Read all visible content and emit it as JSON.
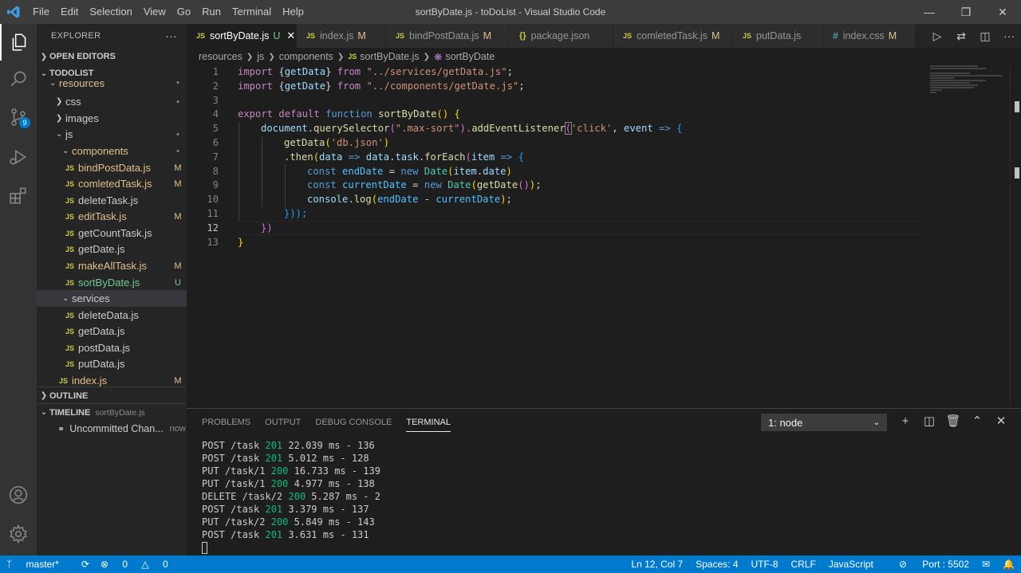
{
  "app": {
    "window_title": "sortByDate.js - toDoList - Visual Studio Code",
    "menu": [
      "File",
      "Edit",
      "Selection",
      "View",
      "Go",
      "Run",
      "Terminal",
      "Help"
    ]
  },
  "sidebar": {
    "title": "EXPLORER",
    "open_editors": "OPEN EDITORS",
    "project": "TODOLIST",
    "tree": [
      {
        "label": "resources",
        "status": "•"
      },
      {
        "label": "css",
        "status": "•"
      },
      {
        "label": "images",
        "status": ""
      },
      {
        "label": "js",
        "status": "•"
      },
      {
        "label": "components",
        "status": "•"
      },
      {
        "label": "bindPostData.js",
        "status": "M"
      },
      {
        "label": "comletedTask.js",
        "status": "M"
      },
      {
        "label": "deleteTask.js",
        "status": ""
      },
      {
        "label": "editTask.js",
        "status": "M"
      },
      {
        "label": "getCountTask.js",
        "status": ""
      },
      {
        "label": "getDate.js",
        "status": ""
      },
      {
        "label": "makeAllTask.js",
        "status": "M"
      },
      {
        "label": "sortByDate.js",
        "status": "U"
      },
      {
        "label": "services",
        "status": ""
      },
      {
        "label": "deleteData.js",
        "status": ""
      },
      {
        "label": "getData.js",
        "status": ""
      },
      {
        "label": "postData.js",
        "status": ""
      },
      {
        "label": "putData.js",
        "status": ""
      },
      {
        "label": "index.js",
        "status": "M"
      }
    ],
    "outline": "OUTLINE",
    "timeline": "TIMELINE",
    "timeline_file": "sortByDate.js",
    "timeline_item": "Uncommitted Chan...",
    "timeline_time": "now"
  },
  "tabs": [
    {
      "label": "sortByDate.js",
      "status": "U",
      "icon": "JS"
    },
    {
      "label": "index.js",
      "status": "M",
      "icon": "JS"
    },
    {
      "label": "bindPostData.js",
      "status": "M",
      "icon": "JS"
    },
    {
      "label": "package.json",
      "status": "",
      "icon": "{}"
    },
    {
      "label": "comletedTask.js",
      "status": "M",
      "icon": "JS"
    },
    {
      "label": "putData.js",
      "status": "",
      "icon": "JS"
    },
    {
      "label": "index.css",
      "status": "M",
      "icon": "#"
    }
  ],
  "breadcrumb": [
    "resources",
    "js",
    "components",
    "sortByDate.js",
    "sortByDate"
  ],
  "editor": {
    "line_numbers": [
      "1",
      "2",
      "3",
      "4",
      "5",
      "6",
      "7",
      "8",
      "9",
      "10",
      "11",
      "12",
      "13"
    ],
    "code": {
      "l1_kw": "import",
      "l1_a": " {",
      "l1_v": "getData",
      "l1_b": "} ",
      "l1_from": "from",
      "l1_str": " \"../services/getData.js\"",
      "l1_end": ";",
      "l2_kw": "import",
      "l2_a": " {",
      "l2_v": "getDate",
      "l2_b": "} ",
      "l2_from": "from",
      "l2_str": " \"../components/getDate.js\"",
      "l2_end": ";",
      "l4_export": "export",
      "l4_default": " default",
      "l4_function": " function",
      "l4_name": " sortByDate",
      "l4_p": "()",
      "l4_brace": " {",
      "l5_doc": "document",
      "l5_dot": ".",
      "l5_qs": "querySelector",
      "l5_p1": "(",
      "l5_str": "\".max-sort\"",
      "l5_p2": ").",
      "l5_ael": "addEventListener",
      "l5_p3": "(",
      "l5_str2": "'click'",
      "l5_comma": ", ",
      "l5_event": "event",
      "l5_arrow": " =>",
      "l5_brace": " {",
      "l6_fn": "getData",
      "l6_p1": "(",
      "l6_str": "'db.json'",
      "l6_p2": ")",
      "l7_dot": ".",
      "l7_then": "then",
      "l7_p1": "(",
      "l7_data": "data",
      "l7_arrow": " =>",
      "l7_data2": " data",
      "l7_dot2": ".",
      "l7_task": "task",
      "l7_dot3": ".",
      "l7_fe": "forEach",
      "l7_p2": "(",
      "l7_item": "item",
      "l7_arrow2": " =>",
      "l7_brace": " {",
      "l8_const": "const",
      "l8_var": " endDate",
      "l8_eq": " =",
      "l8_new": " new",
      "l8_cls": " Date",
      "l8_p1": "(",
      "l8_item": "item",
      "l8_dot": ".",
      "l8_date": "date",
      "l8_p2": ")",
      "l9_const": "const",
      "l9_var": " currentDate",
      "l9_eq": " =",
      "l9_new": " new",
      "l9_cls": " Date",
      "l9_p1": "(",
      "l9_fn": "getDate",
      "l9_p2": "()",
      "l9_p3": ")",
      "l9_end": ";",
      "l10_console": "console",
      "l10_dot": ".",
      "l10_log": "log",
      "l10_p1": "(",
      "l10_a": "endDate",
      "l10_minus": " - ",
      "l10_b": "currentDate",
      "l10_p2": ")",
      "l10_end": ";",
      "l11": "}));",
      "l12": "})",
      "l13": "}"
    }
  },
  "panel": {
    "tabs": [
      "PROBLEMS",
      "OUTPUT",
      "DEBUG CONSOLE",
      "TERMINAL"
    ],
    "terminal_select": "1: node",
    "lines": [
      {
        "pre": "POST /task ",
        "code": "201",
        "post": " 22.039 ms - 136"
      },
      {
        "pre": "POST /task ",
        "code": "201",
        "post": " 5.012 ms - 128"
      },
      {
        "pre": "PUT /task/1 ",
        "code": "200",
        "post": " 16.733 ms - 139"
      },
      {
        "pre": "PUT /task/1 ",
        "code": "200",
        "post": " 4.977 ms - 138"
      },
      {
        "pre": "DELETE /task/2 ",
        "code": "200",
        "post": " 5.287 ms - 2"
      },
      {
        "pre": "POST /task ",
        "code": "201",
        "post": " 3.379 ms - 137"
      },
      {
        "pre": "PUT /task/2 ",
        "code": "200",
        "post": " 5.849 ms - 143"
      },
      {
        "pre": "POST /task ",
        "code": "201",
        "post": " 3.631 ms - 131"
      }
    ]
  },
  "status": {
    "branch": "master*",
    "errors": "0",
    "warnings": "0",
    "position": "Ln 12, Col 7",
    "spaces": "Spaces: 4",
    "encoding": "UTF-8",
    "eol": "CRLF",
    "language": "JavaScript",
    "port": "Port : 5502"
  },
  "colors": {
    "accent": "#007acc",
    "activity_bar": "#333333",
    "sidebar": "#252526",
    "editor": "#1e1e1e",
    "modified": "#e2c08d",
    "untracked": "#73c991"
  }
}
